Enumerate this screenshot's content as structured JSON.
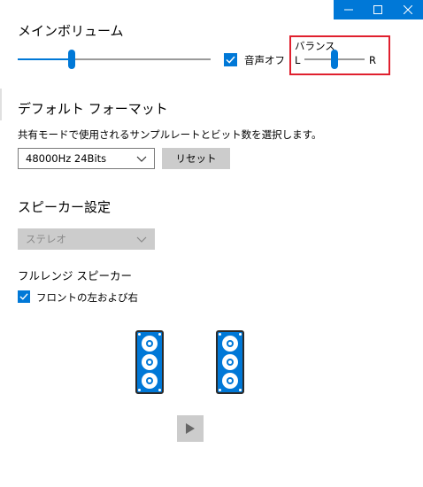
{
  "window": {
    "minimize_glyph": "—",
    "maximize_glyph": "☐",
    "close_glyph": "✕"
  },
  "main_volume": {
    "title": "メインボリューム",
    "level": 0.28,
    "mute_label": "音声オフ",
    "mute_checked": true
  },
  "balance": {
    "title": "バランス",
    "left_label": "L",
    "right_label": "R",
    "value": 0.5
  },
  "default_format": {
    "title": "デフォルト フォーマット",
    "description": "共有モードで使用されるサンプルレートとビット数を選択します。",
    "selected": "48000Hz 24Bits",
    "reset_label": "リセット"
  },
  "speaker_setup": {
    "title": "スピーカー設定",
    "selected": "ステレオ"
  },
  "full_range": {
    "title": "フルレンジ スピーカー",
    "front_label": "フロントの左および右",
    "front_checked": true
  },
  "colors": {
    "accent": "#0078d7",
    "highlight": "#e0202e"
  },
  "icons": [
    "minimize-icon",
    "maximize-icon",
    "close-icon",
    "checkmark-icon",
    "chevron-down-icon",
    "speaker-icon",
    "play-icon"
  ]
}
